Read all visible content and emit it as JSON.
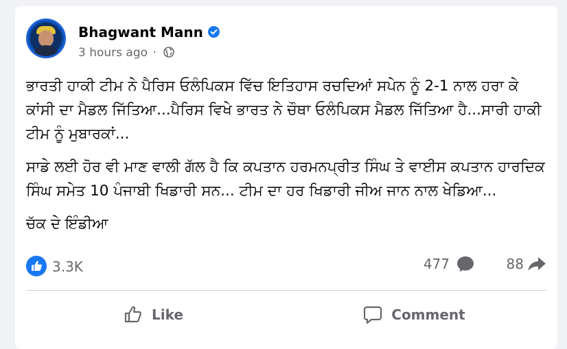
{
  "post": {
    "author": "Bhagwant Mann",
    "verified": true,
    "timestamp": "3 hours ago",
    "separator": "·",
    "visibility_icon": "globe-icon",
    "paragraphs": [
      "ਭਾਰਤੀ ਹਾਕੀ ਟੀਮ ਨੇ ਪੈਰਿਸ ਓਲੰਪਿਕਸ ਵਿੱਚ ਇਤਿਹਾਸ ਰਚਦਿਆਂ ਸਪੇਨ ਨੂੰ 2-1 ਨਾਲ ਹਰਾ ਕੇ ਕਾਂਸੀ ਦਾ ਮੈਡਲ ਜਿੱਤਿਆ...ਪੈਰਿਸ ਵਿਖੇ ਭਾਰਤ ਨੇ ਚੌਥਾ ਓਲੰਪਿਕਸ ਮੈਡਲ ਜਿੱਤਿਆ ਹੈ...ਸਾਰੀ ਹਾਕੀ ਟੀਮ ਨੂੰ ਮੁਬਾਰਕਾਂ...",
      "ਸਾਡੇ ਲਈ ਹੋਰ ਵੀ ਮਾਣ ਵਾਲੀ ਗੱਲ ਹੈ ਕਿ ਕਪਤਾਨ ਹਰਮਨਪ੍ਰੀਤ ਸਿੰਘ ਤੇ ਵਾਈਸ ਕਪਤਾਨ ਹਾਰਦਿਕ ਸਿੰਘ ਸਮੇਤ 10 ਪੰਜਾਬੀ ਖਿਡਾਰੀ ਸਨ... ਟੀਮ ਦਾ ਹਰ ਖਿਡਾਰੀ ਜੀਅ ਜਾਨ ਨਾਲ ਖੇਡਿਆ...",
      "ਚੱਕ ਦੇ ਇੰਡੀਆ"
    ]
  },
  "stats": {
    "reactions": "3.3K",
    "comments": "477",
    "shares": "88"
  },
  "actions": {
    "like_label": "Like",
    "comment_label": "Comment"
  },
  "colors": {
    "accent": "#1877f2",
    "secondary_text": "#65676b",
    "background": "#f0f2f5"
  }
}
